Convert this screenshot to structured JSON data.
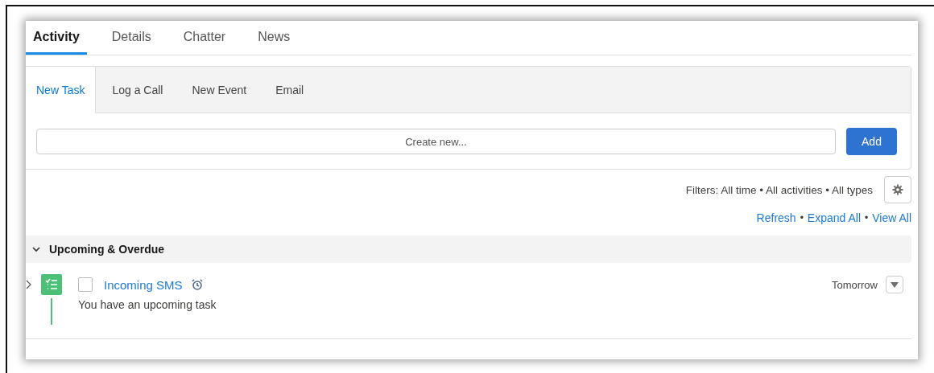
{
  "tabs": [
    {
      "label": "Activity",
      "selected": true
    },
    {
      "label": "Details",
      "selected": false
    },
    {
      "label": "Chatter",
      "selected": false
    },
    {
      "label": "News",
      "selected": false
    }
  ],
  "composer": {
    "tabs": [
      {
        "label": "New Task",
        "selected": true
      },
      {
        "label": "Log a Call",
        "selected": false
      },
      {
        "label": "New Event",
        "selected": false
      },
      {
        "label": "Email",
        "selected": false
      }
    ],
    "input": {
      "placeholder": "Create new..."
    },
    "button": "Add"
  },
  "filters": {
    "text": "Filters: All time • All activities • All types"
  },
  "links": {
    "separator": "•",
    "items": [
      "Refresh",
      "Expand All",
      "View All"
    ]
  },
  "sections": [
    {
      "title": "Upcoming & Overdue",
      "expanded": true,
      "items": [
        {
          "title": "Incoming SMS",
          "checked": false,
          "description": "You have an upcoming task",
          "date": "Tomorrow",
          "color": "#4bc076"
        }
      ]
    }
  ]
}
